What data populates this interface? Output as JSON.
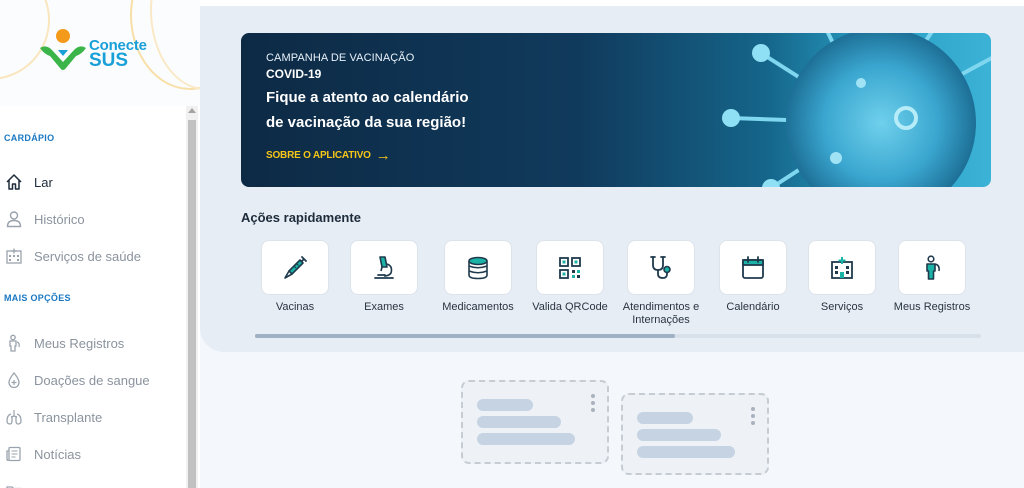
{
  "brand": {
    "line1": "Conecte",
    "line2": "SUS"
  },
  "sidebar": {
    "section_menu": "CARDÁPIO",
    "menu_items": [
      {
        "label": "Lar",
        "icon": "home-icon"
      },
      {
        "label": "Histórico",
        "icon": "person-icon"
      },
      {
        "label": "Serviços de saúde",
        "icon": "hospital-icon"
      }
    ],
    "section_more": "MAIS OPÇÕES",
    "more_items": [
      {
        "label": "Meus Registros",
        "icon": "person-badge-icon"
      },
      {
        "label": "Doações de sangue",
        "icon": "blood-drop-icon"
      },
      {
        "label": "Transplante",
        "icon": "lungs-icon"
      },
      {
        "label": "Notícias",
        "icon": "news-icon"
      }
    ]
  },
  "banner": {
    "subtitle": "CAMPANHA DE VACINAÇÃO",
    "campaign": "COVID-19",
    "headline_1": "Fique a atento ao calendário",
    "headline_2": "de vacinação da sua região!",
    "link": "SOBRE O APLICATIVO",
    "link_arrow": "→"
  },
  "quick_actions": {
    "title": "Ações rapidamente",
    "items": [
      {
        "label": "Vacinas",
        "icon": "syringe-icon"
      },
      {
        "label": "Exames",
        "icon": "microscope-icon"
      },
      {
        "label": "Medicamentos",
        "icon": "pill-icon"
      },
      {
        "label": "Valida QRCode",
        "icon": "qrcode-icon"
      },
      {
        "label": "Atendimentos e Internações",
        "icon": "stethoscope-icon"
      },
      {
        "label": "Calendário",
        "icon": "calendar-icon"
      },
      {
        "label": "Serviços",
        "icon": "hospital-icon"
      },
      {
        "label": "Meus Registros",
        "icon": "person-badge-icon"
      }
    ]
  },
  "colors": {
    "accent_blue": "#1a78c2",
    "icon_dark": "#1f3a4d",
    "icon_teal": "#1bb3a6",
    "link_yellow": "#f5c518"
  }
}
